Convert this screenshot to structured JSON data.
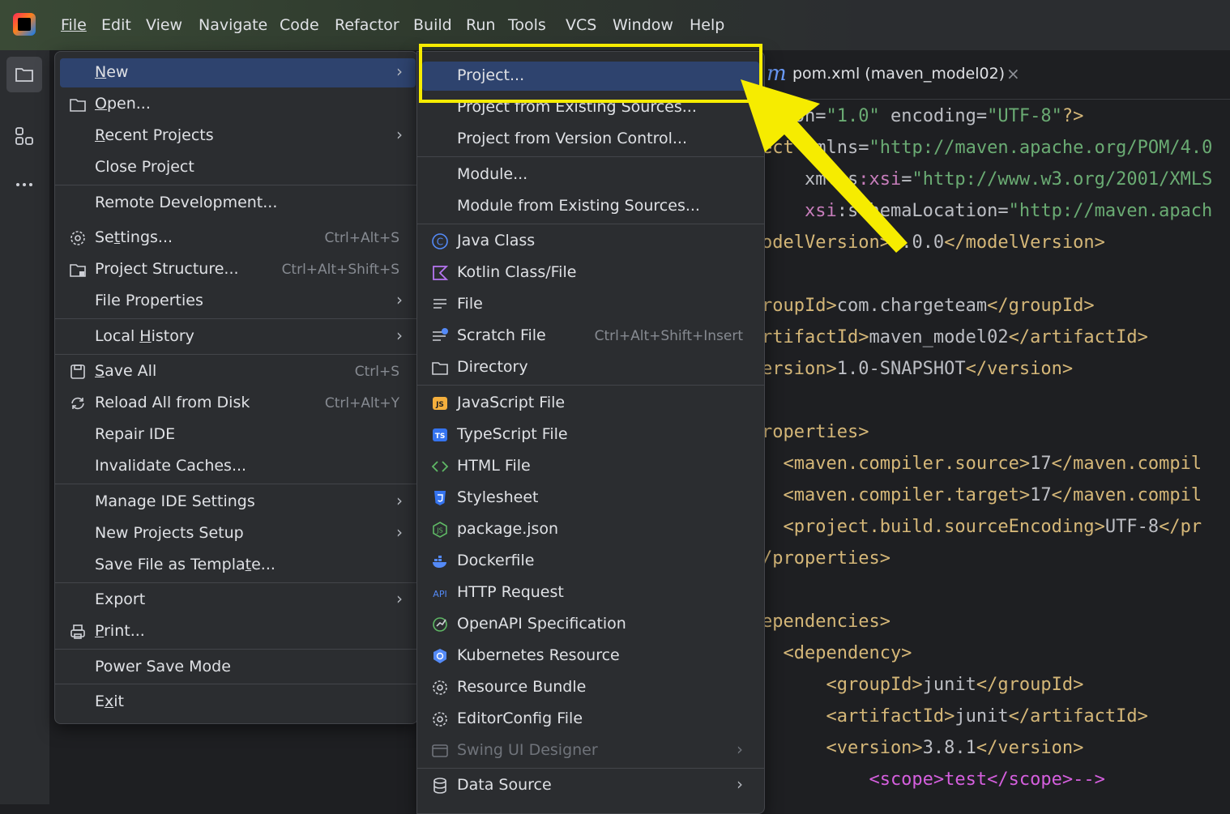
{
  "menubar": {
    "items": [
      "File",
      "Edit",
      "View",
      "Navigate",
      "Code",
      "Refactor",
      "Build",
      "Run",
      "Tools",
      "VCS",
      "Window",
      "Help"
    ]
  },
  "tab": {
    "icon_letter": "m",
    "label": "pom.xml (maven_model02)",
    "close": "×"
  },
  "code_lines": [
    {
      "parts": [
        {
          "t": "rsion=",
          "c": "#bcbec4"
        },
        {
          "t": "\"1.0\"",
          "c": "#6aab73"
        },
        {
          "t": " encoding=",
          "c": "#bcbec4"
        },
        {
          "t": "\"UTF-8\"",
          "c": "#6aab73"
        },
        {
          "t": "?>",
          "c": "#d5b778"
        }
      ]
    },
    {
      "parts": [
        {
          "t": "ect ",
          "c": "#d5b778"
        },
        {
          "t": "xmlns=",
          "c": "#bcbec4"
        },
        {
          "t": "\"http://maven.apache.org/POM/4.0",
          "c": "#6aab73"
        }
      ]
    },
    {
      "parts": [
        {
          "t": "    xmlns",
          "c": "#bcbec4"
        },
        {
          "t": ":xsi",
          "c": "#c77dbb"
        },
        {
          "t": "=",
          "c": "#bcbec4"
        },
        {
          "t": "\"http://www.w3.org/2001/XMLS",
          "c": "#6aab73"
        }
      ]
    },
    {
      "parts": [
        {
          "t": "    xsi",
          "c": "#c77dbb"
        },
        {
          "t": ":schemaLocation=",
          "c": "#bcbec4"
        },
        {
          "t": "\"http://maven.apach",
          "c": "#6aab73"
        }
      ]
    },
    {
      "parts": [
        {
          "t": "odelVersion>",
          "c": "#d5b778"
        },
        {
          "t": "4.0.0",
          "c": "#bcbec4"
        },
        {
          "t": "</modelVersion>",
          "c": "#d5b778"
        }
      ]
    },
    {
      "parts": []
    },
    {
      "parts": [
        {
          "t": "roupId>",
          "c": "#d5b778"
        },
        {
          "t": "com.chargeteam",
          "c": "#bcbec4"
        },
        {
          "t": "</groupId>",
          "c": "#d5b778"
        }
      ]
    },
    {
      "parts": [
        {
          "t": "rtifactId>",
          "c": "#d5b778"
        },
        {
          "t": "maven_model02",
          "c": "#bcbec4"
        },
        {
          "t": "</artifactId>",
          "c": "#d5b778"
        }
      ]
    },
    {
      "parts": [
        {
          "t": "ersion>",
          "c": "#d5b778"
        },
        {
          "t": "1.0-SNAPSHOT",
          "c": "#bcbec4"
        },
        {
          "t": "</version>",
          "c": "#d5b778"
        }
      ]
    },
    {
      "parts": []
    },
    {
      "parts": [
        {
          "t": "roperties>",
          "c": "#d5b778"
        }
      ]
    },
    {
      "parts": [
        {
          "t": "  <maven.compiler.source>",
          "c": "#d5b778"
        },
        {
          "t": "17",
          "c": "#bcbec4"
        },
        {
          "t": "</maven.compil",
          "c": "#d5b778"
        }
      ]
    },
    {
      "parts": [
        {
          "t": "  <maven.compiler.target>",
          "c": "#d5b778"
        },
        {
          "t": "17",
          "c": "#bcbec4"
        },
        {
          "t": "</maven.compil",
          "c": "#d5b778"
        }
      ]
    },
    {
      "parts": [
        {
          "t": "  <project.build.sourceEncoding>",
          "c": "#d5b778"
        },
        {
          "t": "UTF-8",
          "c": "#bcbec4"
        },
        {
          "t": "</pr",
          "c": "#d5b778"
        }
      ]
    },
    {
      "parts": [
        {
          "t": "/properties>",
          "c": "#d5b778"
        }
      ]
    },
    {
      "parts": []
    },
    {
      "parts": [
        {
          "t": "ependencies>",
          "c": "#d5b778"
        }
      ]
    },
    {
      "parts": [
        {
          "t": "  <dependency>",
          "c": "#d5b778"
        }
      ]
    },
    {
      "parts": [
        {
          "t": "      <groupId>",
          "c": "#d5b778"
        },
        {
          "t": "junit",
          "c": "#bcbec4"
        },
        {
          "t": "</groupId>",
          "c": "#d5b778"
        }
      ]
    },
    {
      "parts": [
        {
          "t": "      <artifactId>",
          "c": "#d5b778"
        },
        {
          "t": "junit",
          "c": "#bcbec4"
        },
        {
          "t": "</artifactId>",
          "c": "#d5b778"
        }
      ]
    },
    {
      "parts": [
        {
          "t": "      <version>",
          "c": "#d5b778"
        },
        {
          "t": "3.8.1",
          "c": "#bcbec4"
        },
        {
          "t": "</version>",
          "c": "#d5b778"
        }
      ]
    },
    {
      "parts": [
        {
          "t": "          <scope>test</scope>-->",
          "c": "#d55fde"
        }
      ]
    }
  ],
  "file_menu": [
    {
      "label": "New",
      "shortcut": "",
      "submenu": true,
      "icon": "",
      "hl": true,
      "u": 0
    },
    {
      "label": "Open...",
      "shortcut": "",
      "submenu": false,
      "icon": "folder-icon",
      "u": 0
    },
    {
      "label": "Recent Projects",
      "shortcut": "",
      "submenu": true,
      "icon": "",
      "u": 0
    },
    {
      "label": "Close Project",
      "shortcut": "",
      "submenu": false,
      "icon": ""
    },
    {
      "label": "Remote Development...",
      "shortcut": "",
      "submenu": false,
      "icon": ""
    },
    {
      "label": "Settings...",
      "shortcut": "Ctrl+Alt+S",
      "submenu": false,
      "icon": "gear-icon",
      "u": 2
    },
    {
      "label": "Project Structure...",
      "shortcut": "Ctrl+Alt+Shift+S",
      "submenu": false,
      "icon": "project-structure-icon"
    },
    {
      "label": "File Properties",
      "shortcut": "",
      "submenu": true,
      "icon": ""
    },
    {
      "label": "Local History",
      "shortcut": "",
      "submenu": true,
      "icon": "",
      "u": 6
    },
    {
      "label": "Save All",
      "shortcut": "Ctrl+S",
      "submenu": false,
      "icon": "save-icon",
      "u": 0
    },
    {
      "label": "Reload All from Disk",
      "shortcut": "Ctrl+Alt+Y",
      "submenu": false,
      "icon": "reload-icon"
    },
    {
      "label": "Repair IDE",
      "shortcut": "",
      "submenu": false,
      "icon": ""
    },
    {
      "label": "Invalidate Caches...",
      "shortcut": "",
      "submenu": false,
      "icon": ""
    },
    {
      "label": "Manage IDE Settings",
      "shortcut": "",
      "submenu": true,
      "icon": ""
    },
    {
      "label": "New Projects Setup",
      "shortcut": "",
      "submenu": true,
      "icon": ""
    },
    {
      "label": "Save File as Template...",
      "shortcut": "",
      "submenu": false,
      "icon": "",
      "u": 19
    },
    {
      "label": "Export",
      "shortcut": "",
      "submenu": true,
      "icon": ""
    },
    {
      "label": "Print...",
      "shortcut": "",
      "submenu": false,
      "icon": "print-icon",
      "u": 0
    },
    {
      "label": "Power Save Mode",
      "shortcut": "",
      "submenu": false,
      "icon": ""
    },
    {
      "label": "Exit",
      "shortcut": "",
      "submenu": false,
      "icon": "",
      "u": 1
    }
  ],
  "new_menu": [
    {
      "label": "Project...",
      "shortcut": "",
      "submenu": false,
      "icon": "",
      "hl": true
    },
    {
      "label": "Project from Existing Sources...",
      "shortcut": "",
      "submenu": false,
      "icon": ""
    },
    {
      "label": "Project from Version Control...",
      "shortcut": "",
      "submenu": false,
      "icon": ""
    },
    {
      "label": "Module...",
      "shortcut": "",
      "submenu": false,
      "icon": ""
    },
    {
      "label": "Module from Existing Sources...",
      "shortcut": "",
      "submenu": false,
      "icon": ""
    },
    {
      "label": "Java Class",
      "shortcut": "",
      "submenu": false,
      "icon": "java-class-icon"
    },
    {
      "label": "Kotlin Class/File",
      "shortcut": "",
      "submenu": false,
      "icon": "kotlin-icon"
    },
    {
      "label": "File",
      "shortcut": "",
      "submenu": false,
      "icon": "file-icon"
    },
    {
      "label": "Scratch File",
      "shortcut": "Ctrl+Alt+Shift+Insert",
      "submenu": false,
      "icon": "scratch-file-icon"
    },
    {
      "label": "Directory",
      "shortcut": "",
      "submenu": false,
      "icon": "folder-icon"
    },
    {
      "label": "JavaScript File",
      "shortcut": "",
      "submenu": false,
      "icon": "javascript-icon"
    },
    {
      "label": "TypeScript File",
      "shortcut": "",
      "submenu": false,
      "icon": "typescript-icon"
    },
    {
      "label": "HTML File",
      "shortcut": "",
      "submenu": false,
      "icon": "html-icon"
    },
    {
      "label": "Stylesheet",
      "shortcut": "",
      "submenu": false,
      "icon": "css-icon"
    },
    {
      "label": "package.json",
      "shortcut": "",
      "submenu": false,
      "icon": "nodejs-icon"
    },
    {
      "label": "Dockerfile",
      "shortcut": "",
      "submenu": false,
      "icon": "docker-icon"
    },
    {
      "label": "HTTP Request",
      "shortcut": "",
      "submenu": false,
      "icon": "api-icon"
    },
    {
      "label": "OpenAPI Specification",
      "shortcut": "",
      "submenu": false,
      "icon": "openapi-icon"
    },
    {
      "label": "Kubernetes Resource",
      "shortcut": "",
      "submenu": false,
      "icon": "kubernetes-icon"
    },
    {
      "label": "Resource Bundle",
      "shortcut": "",
      "submenu": false,
      "icon": "gear-icon"
    },
    {
      "label": "EditorConfig File",
      "shortcut": "",
      "submenu": false,
      "icon": "gear-icon"
    },
    {
      "label": "Swing UI Designer",
      "shortcut": "",
      "submenu": true,
      "icon": "form-icon",
      "disabled": true
    },
    {
      "label": "Data Source",
      "shortcut": "",
      "submenu": true,
      "icon": "database-icon"
    }
  ],
  "icon_text": {
    "js": "JS",
    "ts": "TS",
    "api": "API"
  },
  "colors": {
    "highlight": "#2e436e",
    "callout": "#f6ec00",
    "menu_bg": "#2b2d30"
  }
}
